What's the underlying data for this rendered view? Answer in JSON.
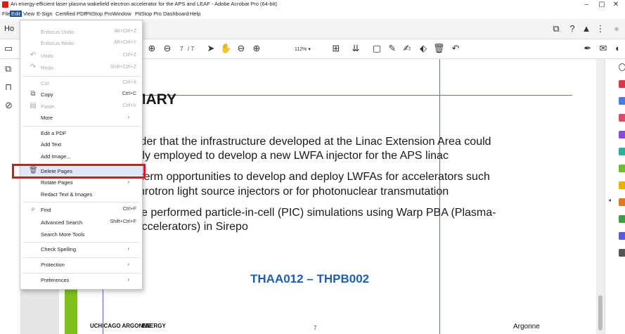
{
  "window": {
    "title": "An energy-efficient laser plasma wakefield electron accelerator for the APS and LEAF - Adobe Acrobat Pro (64-bit)",
    "minimize": "–",
    "restore": "▢",
    "close": "✕"
  },
  "menubar": [
    "File",
    "Edit",
    "View",
    "E-Sign",
    "Certified PDF",
    "PitStop Pro",
    "Window",
    "PitStop Pro Dashboard",
    "Help"
  ],
  "tabs": {
    "home": "Ho"
  },
  "toolbar": {
    "page_current": "7",
    "page_total": "/ 7",
    "zoom": "112%"
  },
  "edit_menu": {
    "items": [
      {
        "label": "Enfocus Undo",
        "shortcut": "Alt+Ctrl+Z",
        "disabled": true
      },
      {
        "label": "Enfocus Redo",
        "shortcut": "Alt+Ctrl+Y",
        "disabled": true
      },
      {
        "label": "Undo",
        "shortcut": "Ctrl+Z",
        "disabled": true
      },
      {
        "label": "Redo",
        "shortcut": "Shift+Ctrl+Z",
        "disabled": true
      },
      {
        "label": "Cut",
        "shortcut": "Ctrl+X",
        "disabled": true
      },
      {
        "label": "Copy",
        "shortcut": "Ctrl+C",
        "disabled": false
      },
      {
        "label": "Paste",
        "shortcut": "Ctrl+V",
        "disabled": true
      },
      {
        "label": "More",
        "shortcut": "",
        "disabled": false
      },
      {
        "label": "Edit a PDF",
        "shortcut": "",
        "disabled": false
      },
      {
        "label": "Add Text",
        "shortcut": "",
        "disabled": false
      },
      {
        "label": "Add Image...",
        "shortcut": "",
        "disabled": false
      },
      {
        "label": "Delete Pages",
        "shortcut": "",
        "disabled": false
      },
      {
        "label": "Rotate Pages",
        "shortcut": "",
        "disabled": false
      },
      {
        "label": "Redact Text & Images",
        "shortcut": "",
        "disabled": false
      },
      {
        "label": "Find",
        "shortcut": "Ctrl+F",
        "disabled": false
      },
      {
        "label": "Advanced Search",
        "shortcut": "Shift+Ctrl+F",
        "disabled": false
      },
      {
        "label": "Search More Tools",
        "shortcut": "",
        "disabled": false
      },
      {
        "label": "Check Spelling",
        "shortcut": "",
        "disabled": false
      },
      {
        "label": "Protection",
        "shortcut": "",
        "disabled": false
      },
      {
        "label": "Preferences",
        "shortcut": "",
        "disabled": false
      }
    ]
  },
  "document": {
    "heading": "MARY",
    "lines": [
      "sider that the infrastructure developed at the Linac Extension Area could",
      "ully employed to develop a new LWFA injector for the APS linac",
      "term opportunities to develop and deploy LWFAs for accelerators such",
      "hrotron light source injectors or for photonuclear transmutation",
      "e performed particle-in-cell (PIC) simulations using Warp PBA (Plasma-",
      "Accelerators) in Sirepo"
    ],
    "code": "THAA012 – THPB002",
    "page_number": "7",
    "footer_left": "UCHICAGO ARGONNE",
    "footer_energy": "ENERGY",
    "footer_right": "Argonne"
  },
  "colors": {
    "menu_active": "#1b4fa6",
    "highlight_box": "#e0141e",
    "code_blue": "#1f5fa8",
    "green_bar": "#7fbf1f",
    "guide": "#5a6fd1"
  }
}
